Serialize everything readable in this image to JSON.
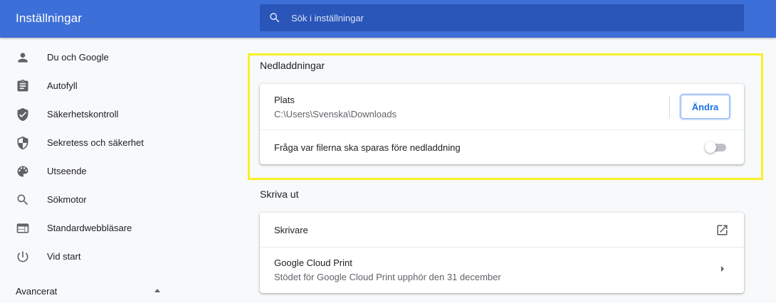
{
  "header": {
    "title": "Inställningar",
    "search": {
      "placeholder": "Sök i inställningar",
      "value": ""
    }
  },
  "sidebar": {
    "items": [
      {
        "label": "Du och Google",
        "icon": "person-icon"
      },
      {
        "label": "Autofyll",
        "icon": "clipboard-icon"
      },
      {
        "label": "Säkerhetskontroll",
        "icon": "shield-check-icon"
      },
      {
        "label": "Sekretess och säkerhet",
        "icon": "shield-half-icon"
      },
      {
        "label": "Utseende",
        "icon": "palette-icon"
      },
      {
        "label": "Sökmotor",
        "icon": "search-icon"
      },
      {
        "label": "Standardwebbläsare",
        "icon": "browser-icon"
      },
      {
        "label": "Vid start",
        "icon": "power-icon"
      }
    ],
    "advanced": {
      "label": "Avancerat",
      "expanded": true
    }
  },
  "downloads": {
    "title": "Nedladdningar",
    "location": {
      "label": "Plats",
      "path": "C:\\Users\\Svenska\\Downloads",
      "button": "Ändra"
    },
    "ask": {
      "label": "Fråga var filerna ska sparas före nedladdning",
      "enabled": false
    }
  },
  "printing": {
    "title": "Skriva ut",
    "printers": {
      "label": "Skrivare",
      "icon": "open-in-new-icon"
    },
    "cloud_print": {
      "label": "Google Cloud Print",
      "description": "Stödet för Google Cloud Print upphör den 31 december",
      "icon": "chevron-right-icon"
    }
  },
  "colors": {
    "header_bg": "#3c6fd8",
    "search_bg": "#2a55b9",
    "accent": "#1a73e8",
    "highlight": "#f8f028",
    "icon": "#5f6368"
  }
}
